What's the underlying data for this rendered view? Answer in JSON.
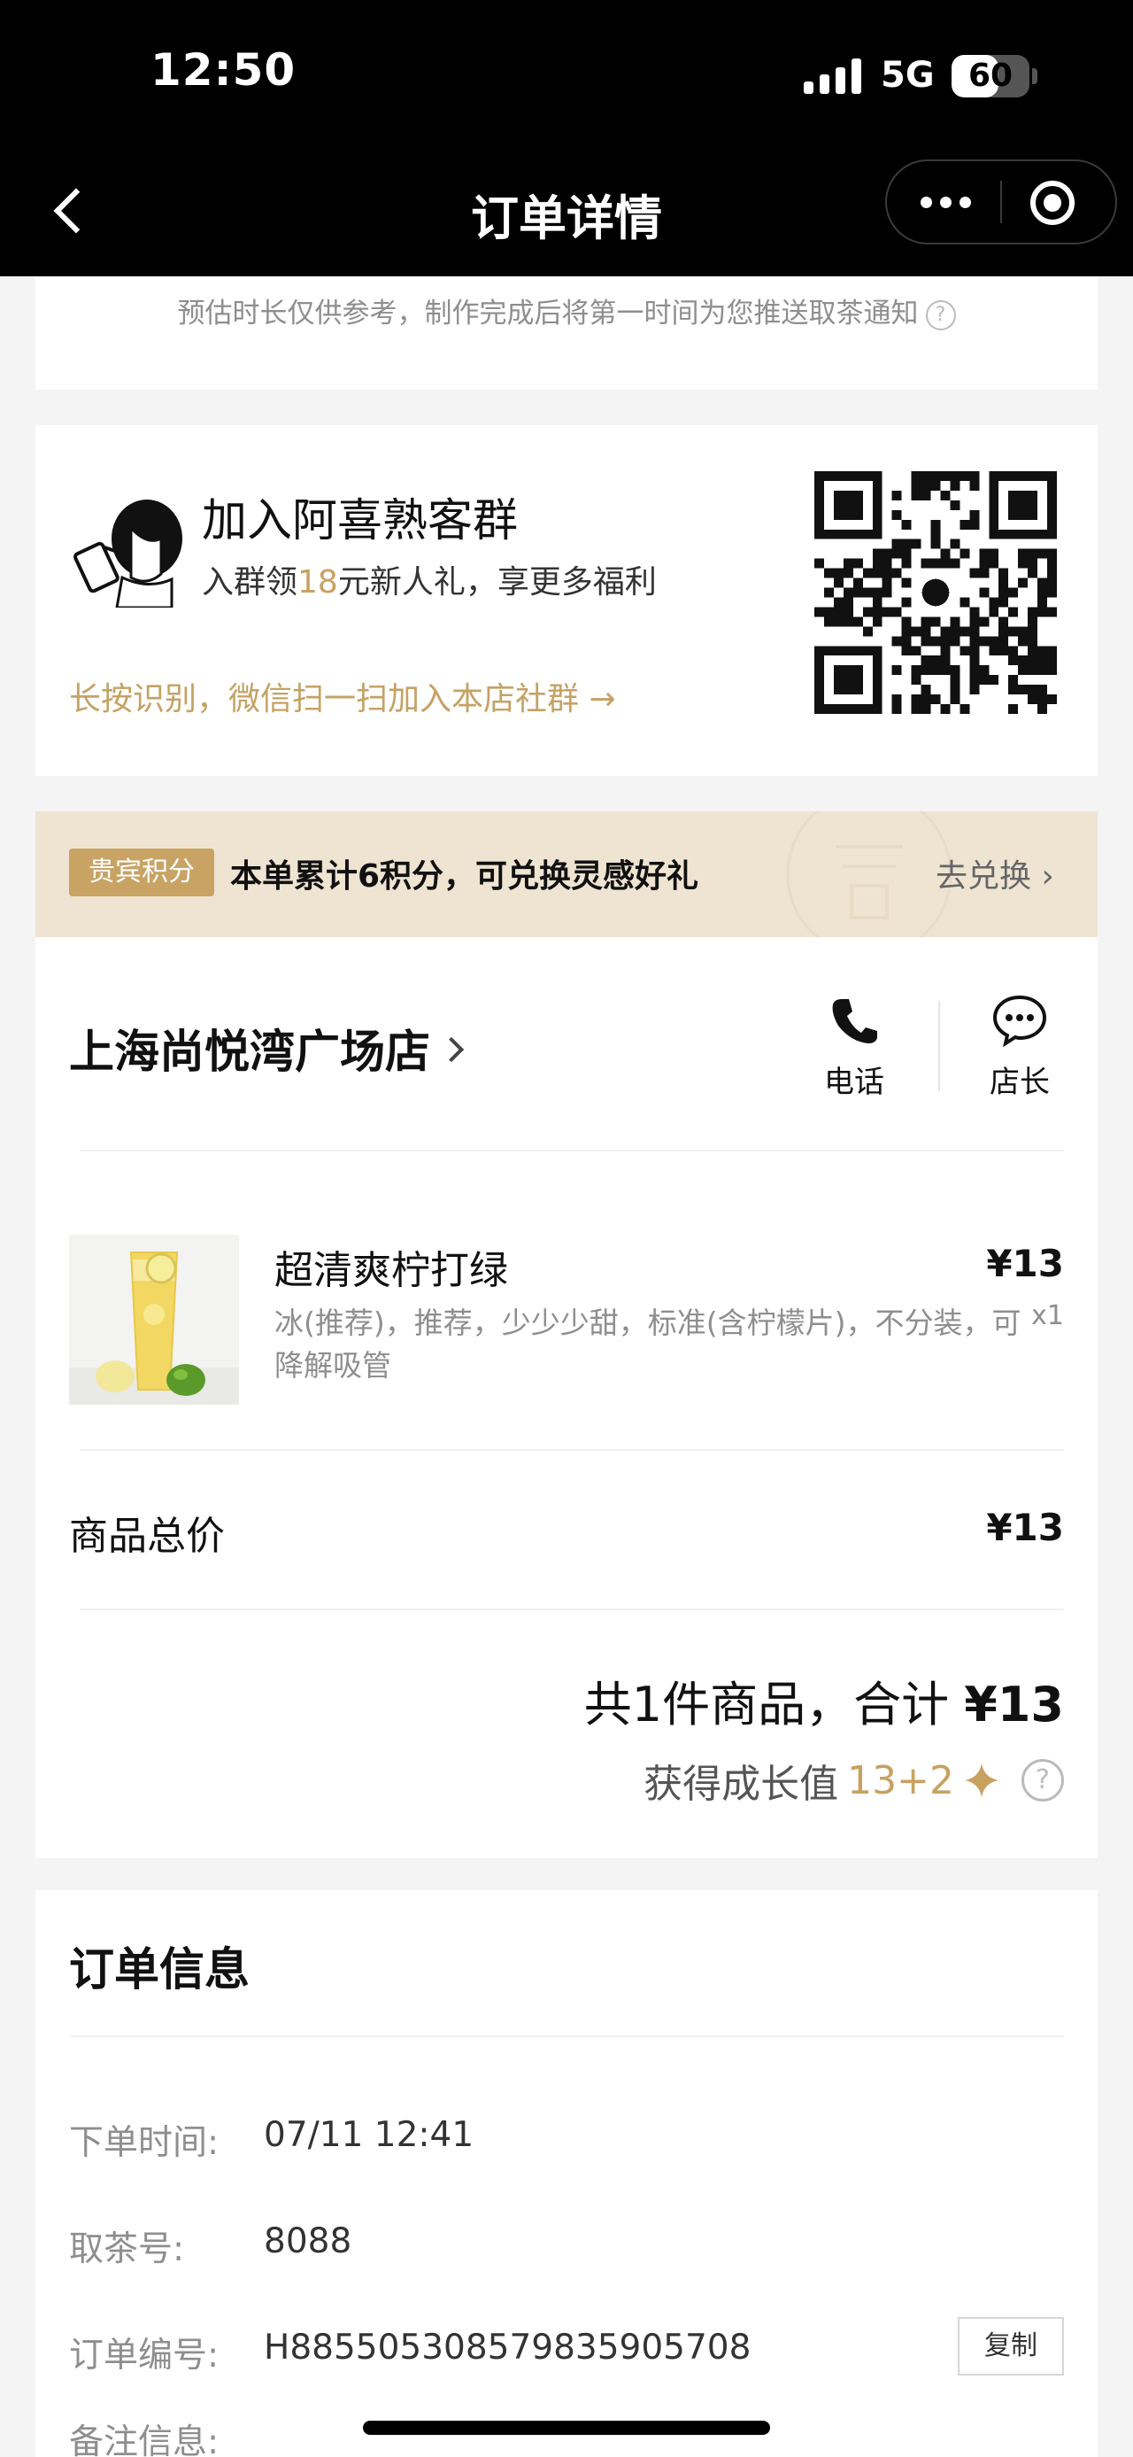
{
  "status_bar": {
    "time": "12:50",
    "network": "5G",
    "battery": "60",
    "battery_level": 0.6
  },
  "nav": {
    "title": "订单详情"
  },
  "pickup_note": {
    "text": "预估时长仅供参考，制作完成后将第一时间为您推送取茶通知",
    "help_icon": "?"
  },
  "group": {
    "title": "加入阿喜熟客群",
    "sub_prefix": "入群领",
    "sub_amount": "18",
    "sub_suffix": "元新人礼，享更多福利",
    "link": "长按识别，微信扫一扫加入本店社群 →",
    "qr_icon": "qr-code"
  },
  "points": {
    "badge": "贵宾积分",
    "text": "本单累计6积分，可兑换灵感好礼",
    "action": "去兑换",
    "chevron": "›"
  },
  "store": {
    "name": "上海尚悦湾广场店",
    "phone_label": "电话",
    "manager_label": "店长"
  },
  "product": {
    "name": "超清爽柠打绿",
    "options": "冰(推荐)，推荐，少少少甜，标准(含柠檬片)，不分装，可降解吸管",
    "price": "¥13",
    "qty": "x1"
  },
  "subtotal": {
    "label": "商品总价",
    "value": "¥13"
  },
  "total": {
    "prefix": "共1件商品，合计",
    "value": "¥13"
  },
  "growth": {
    "label": "获得成长值",
    "value": "13+2",
    "help_icon": "?"
  },
  "order_info": {
    "title": "订单信息",
    "rows": [
      {
        "label": "下单时间:",
        "value": "07/11 12:41"
      },
      {
        "label": "取茶号:",
        "value": "8088"
      },
      {
        "label": "订单编号:",
        "value": "H885505308579835905708"
      },
      {
        "label": "备注信息:",
        "value": ""
      }
    ],
    "copy_label": "复制"
  }
}
